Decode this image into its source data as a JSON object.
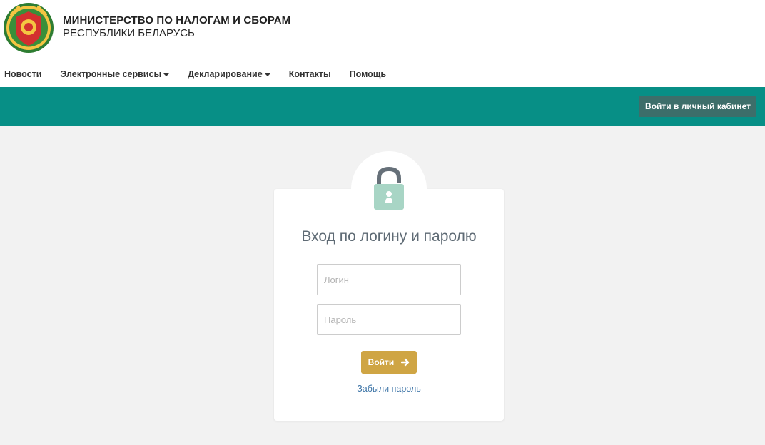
{
  "header": {
    "org_line1": "МИНИСТЕРСТВО ПО НАЛОГАМ И СБОРАМ",
    "org_line2": "РЕСПУБЛИКИ БЕЛАРУСЬ",
    "logo_icon": "emblem-icon"
  },
  "nav": {
    "items": [
      {
        "label": "Новости",
        "dropdown": false
      },
      {
        "label": "Электронные сервисы",
        "dropdown": true
      },
      {
        "label": "Декларирование",
        "dropdown": true
      },
      {
        "label": "Контакты",
        "dropdown": false
      },
      {
        "label": "Помощь",
        "dropdown": false
      }
    ]
  },
  "topbar": {
    "cabinet_label": "Войти в личный кабинет"
  },
  "login": {
    "title": "Вход по логину и паролю",
    "login_placeholder": "Логин",
    "login_value": "",
    "password_placeholder": "Пароль",
    "password_value": "",
    "submit_label": "Войти",
    "forgot_label": "Забыли пароль"
  },
  "colors": {
    "teal": "#078f86",
    "cabinet_button": "#3d6e6a",
    "submit_button": "#cfa544",
    "link": "#3b73a6",
    "lock_body": "#a8d5c5",
    "lock_shackle": "#667079"
  }
}
